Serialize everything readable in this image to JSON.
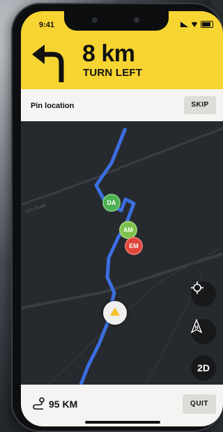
{
  "status_bar": {
    "time": "9:41"
  },
  "navigation": {
    "distance": "8 km",
    "instruction": "TURN LEFT"
  },
  "pin_bar": {
    "label": "Pin location",
    "skip_label": "SKIP"
  },
  "map": {
    "street_label": "Leo Road",
    "markers": [
      {
        "initials": "DA",
        "color": "#4caf50"
      },
      {
        "initials": "AM",
        "color": "#7cc24a"
      },
      {
        "initials": "EM",
        "color": "#e0443a"
      }
    ],
    "controls": {
      "view_mode": "2D"
    },
    "icons": [
      "crosshair-icon",
      "compass-north-icon",
      "turn-left-arrow-icon",
      "route-icon"
    ],
    "route_color": "#3b6fe0"
  },
  "bottom_bar": {
    "remaining_distance": "95 KM",
    "quit_label": "QUIT"
  },
  "colors": {
    "header_yellow": "#f6d431",
    "panel": "#f4f4f2",
    "map_bg": "#26292d"
  }
}
